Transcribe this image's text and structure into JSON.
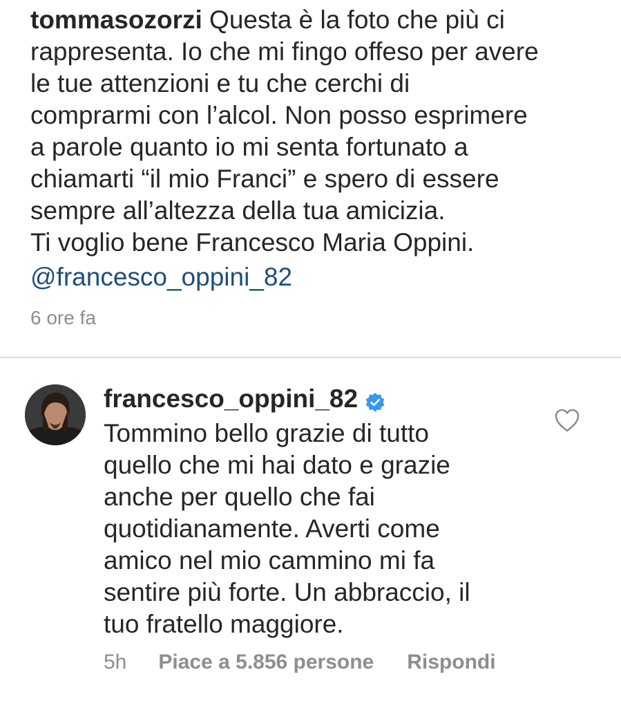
{
  "caption": {
    "username": "tommasozorzi",
    "lines": [
      " Questa è la foto che più ci",
      "rappresenta. Io che mi fingo offeso per avere",
      "le tue attenzioni e tu che cerchi di",
      "comprarmi con l’alcol. Non posso esprimere",
      "a parole quanto io mi senta fortunato a",
      "chiamarti “il mio Franci” e spero di essere",
      "sempre all’altezza della tua amicizia.",
      "Ti voglio bene Francesco Maria Oppini."
    ],
    "mention": "@francesco_oppini_82",
    "time": "6 ore fa"
  },
  "comment": {
    "username": "francesco_oppini_82",
    "verified_icon": "verified-badge-icon",
    "lines": [
      "Tommino bello grazie di tutto",
      "quello che mi hai dato e grazie",
      "anche per quello che fai",
      "quotidianamente. Averti come",
      "amico nel mio cammino mi fa",
      "sentire più forte. Un abbraccio, il",
      "tuo fratello maggiore."
    ],
    "time": "5h",
    "likes_label": "Piace a 5.856 persone",
    "reply_label": "Rispondi",
    "like_icon": "heart-outline-icon"
  },
  "colors": {
    "text": "#262626",
    "secondary": "#8e8e8e",
    "mention": "#1d4f7a",
    "verified": "#3897f0",
    "divider": "#dbdbdb"
  }
}
